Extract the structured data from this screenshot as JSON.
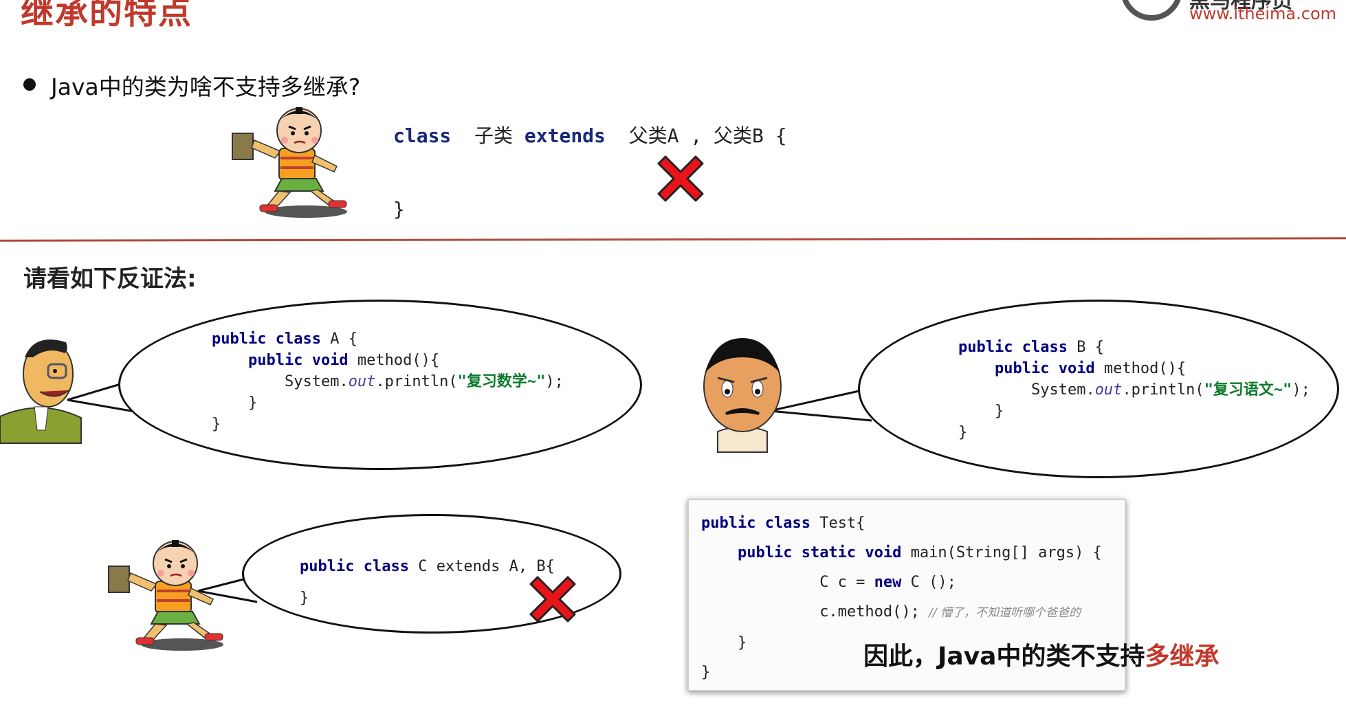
{
  "header": {
    "title": "继承的特点",
    "logo_cn": "黑马程序员",
    "logo_url": "www.itheima.com"
  },
  "question": {
    "text": "Java中的类为啥不支持多继承?"
  },
  "top_code": {
    "kw_class": "class",
    "child": "子类",
    "kw_extends": "extends",
    "parents": "父类A , 父类B {",
    "close": "}"
  },
  "section": {
    "heading": "请看如下反证法:"
  },
  "bubble_a": {
    "l1_kw": "public class",
    "l1_rest": " A {",
    "l2_kw": "public void",
    "l2_rest": " method(){",
    "l3_pre": "System.",
    "l3_out": "out",
    "l3_mid": ".println(",
    "l3_str": "\"复习数学~\"",
    "l3_end": ");",
    "l4": "}",
    "l5": "}"
  },
  "bubble_b": {
    "l1_kw": "public class",
    "l1_rest": " B {",
    "l2_kw": "public void",
    "l2_rest": " method(){",
    "l3_pre": "System.",
    "l3_out": "out",
    "l3_mid": ".println(",
    "l3_str": "\"复习语文~\"",
    "l3_end": ");",
    "l4": "}",
    "l5": "}"
  },
  "bubble_c": {
    "l1_kw": "public class",
    "l1_rest": " C extends A, B{",
    "l2": "}"
  },
  "test_box": {
    "l1_kw": "public class",
    "l1_rest": " Test{",
    "l2_kw": "public static void",
    "l2_rest": " main(String[] args) {",
    "l3_pre": "C c = ",
    "l3_kw": "new",
    "l3_rest": " C ();",
    "l4_code": "c.method(); ",
    "l4_comment": "// 懵了，不知道听哪个爸爸的",
    "l5": "}",
    "l6": "}"
  },
  "conclusion": {
    "prefix": "因此，Java中的类不支持",
    "highlight": "多继承"
  },
  "colors": {
    "title_red": "#c0392b",
    "keyword_blue": "#1a2a7a",
    "string_green": "#0a7a2a",
    "cross_red": "#e8141a"
  }
}
